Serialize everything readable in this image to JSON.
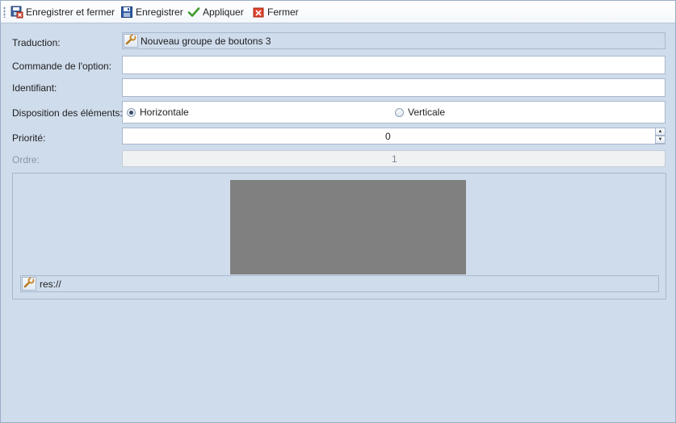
{
  "toolbar": {
    "save_close": "Enregistrer et fermer",
    "save": "Enregistrer",
    "apply": "Appliquer",
    "close": "Fermer"
  },
  "form": {
    "translation_label": "Traduction:",
    "translation_value": "Nouveau groupe de boutons 3",
    "command_label": "Commande de l'option:",
    "command_value": "",
    "identifier_label": "Identifiant:",
    "identifier_value": "",
    "layout_label": "Disposition des éléments:",
    "layout_options": [
      "Horizontale",
      "Verticale"
    ],
    "layout_selected": "Horizontale",
    "priority_label": "Priorité:",
    "priority_value": "0",
    "order_label": "Ordre:",
    "order_value": "1"
  },
  "image_group": {
    "resource_path": "res://"
  },
  "colors": {
    "background": "#cfdcec",
    "border": "#a8b8cc",
    "preview": "#808080"
  }
}
